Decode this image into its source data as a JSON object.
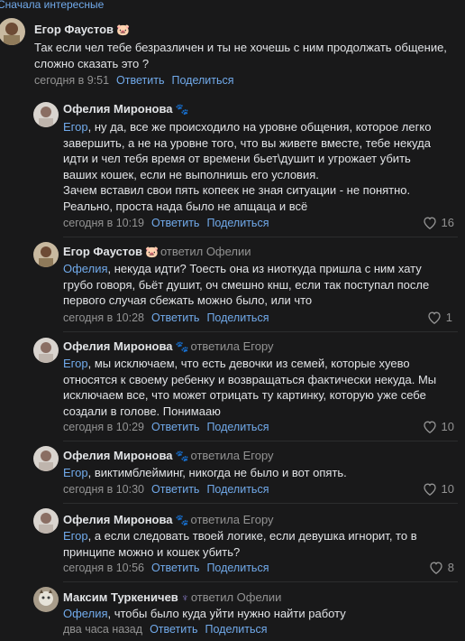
{
  "topbar": {
    "label": "Сначала интересные"
  },
  "comments": [
    {
      "author": "Егор Фаустов",
      "badge": "🐷",
      "reply_to": "",
      "mention": "",
      "text": "Так если чел тебе безразличен и ты не хочешь с ним продолжать общение, сложно сказать это ?",
      "time": "сегодня в 9:51",
      "reply_label": "Ответить",
      "share_label": "Поделиться",
      "likes": ""
    },
    {
      "author": "Офелия Миронова",
      "badge": "🐾",
      "reply_to": "",
      "mention": "Егор",
      "text": ", ну да, все же происходило на уровне общения, которое легко завершить, а не на уровне того, что вы живете вместе, тебе некуда идти и чел тебя время от времени бьет\\душит и угрожает убить ваших кошек, если не выполнишь его условия.\nЗачем вставил свои пять копеек не зная ситуации - не понятно. Реально, проста нада было не апщаца и всё",
      "time": "сегодня в 10:19",
      "reply_label": "Ответить",
      "share_label": "Поделиться",
      "likes": "16"
    },
    {
      "author": "Егор Фаустов",
      "badge": "🐷",
      "reply_to": "ответил Офелии",
      "mention": "Офелия",
      "text": ", некуда идти? Тоесть она из ниоткуда пришла с ним хату грубо говоря, бьёт душит, оч смешно кнш, если так поступал после первого случая сбежать можно было, или что",
      "time": "сегодня в 10:28",
      "reply_label": "Ответить",
      "share_label": "Поделиться",
      "likes": "1"
    },
    {
      "author": "Офелия Миронова",
      "badge": "🐾",
      "reply_to": "ответила Егору",
      "mention": "Егор",
      "text": ", мы исключаем, что есть девочки из семей, которые хуево относятся к своему ребенку и возвращаться фактически некуда. Мы исключаем все, что может отрицать ту картинку, которую уже себе создали в голове. Понимааю",
      "time": "сегодня в 10:29",
      "reply_label": "Ответить",
      "share_label": "Поделиться",
      "likes": "10"
    },
    {
      "author": "Офелия Миронова",
      "badge": "🐾",
      "reply_to": "ответила Егору",
      "mention": "Егор",
      "text": ", виктимблейминг, никогда не было и вот опять.",
      "time": "сегодня в 10:30",
      "reply_label": "Ответить",
      "share_label": "Поделиться",
      "likes": "10"
    },
    {
      "author": "Офелия Миронова",
      "badge": "🐾",
      "reply_to": "ответила Егору",
      "mention": "Егор",
      "text": ", а если следовать твоей логике, если девушка игнорит, то в принципе можно и кошек убить?",
      "time": "сегодня в 10:56",
      "reply_label": "Ответить",
      "share_label": "Поделиться",
      "likes": "8"
    },
    {
      "author": "Максим Туркеничев",
      "badge": "♆",
      "reply_to": "ответил Офелии",
      "mention": "Офелия",
      "text": ", чтобы было куда уйти нужно найти работу",
      "time": "два часа назад",
      "reply_label": "Ответить",
      "share_label": "Поделиться",
      "likes": ""
    }
  ],
  "colors": {
    "accent": "#71aaeb",
    "muted": "#939393",
    "background": "#19191a",
    "text": "#e1e3e6"
  },
  "icons": {
    "like": "heart-icon"
  }
}
